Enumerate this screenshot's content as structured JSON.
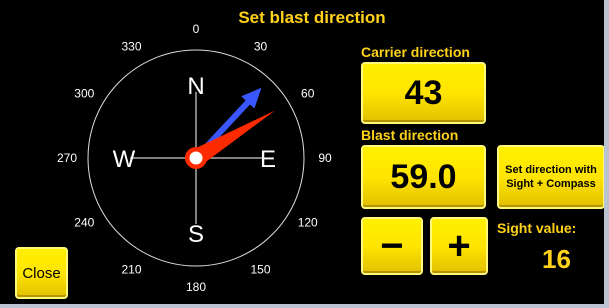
{
  "title": "Set blast direction",
  "compass": {
    "degree_labels": [
      "0",
      "30",
      "60",
      "90",
      "120",
      "150",
      "180",
      "210",
      "240",
      "270",
      "300",
      "330"
    ],
    "cardinals": {
      "north": "N",
      "east": "E",
      "south": "S",
      "west": "W"
    },
    "carrier_heading_deg": 43,
    "blast_heading_deg": 59.0,
    "colors": {
      "carrier_arrow": "#3a57ff",
      "blast_arrow": "#ff2a00",
      "accent": "#ffd21a"
    }
  },
  "carrier": {
    "label": "Carrier direction",
    "value": "43"
  },
  "blast": {
    "label": "Blast direction",
    "value": "59.0"
  },
  "sight_compass_button": {
    "label": "Set direction with Sight + Compass"
  },
  "minus_button": {
    "label": "−"
  },
  "plus_button": {
    "label": "+"
  },
  "sight": {
    "label": "Sight value:",
    "value": "16"
  },
  "close_button": {
    "label": "Close"
  }
}
